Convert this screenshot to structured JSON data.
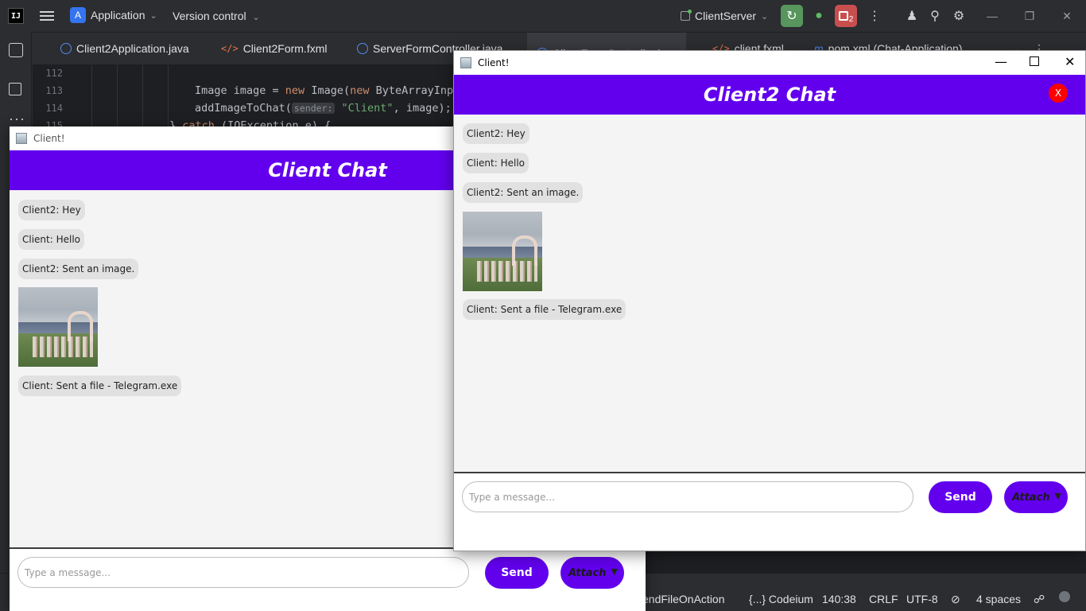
{
  "ide": {
    "logo": "IJ",
    "project": {
      "badge": "A",
      "name": "Application",
      "chevron": "⌵"
    },
    "vcs": "Version control",
    "run_config": "ClientServer",
    "stop_badge": "2",
    "tabs": [
      {
        "label": "Client2Application.java",
        "icon": "class-icon"
      },
      {
        "label": "Client2Form.fxml",
        "icon": "xml-icon"
      },
      {
        "label": "ServerFormController.java",
        "icon": "class-icon"
      },
      {
        "label": "ClientFormController.java",
        "icon": "class-icon"
      },
      {
        "label": "client.fxml",
        "icon": "xml-icon"
      },
      {
        "label": "pom.xml (Chat-Application)",
        "icon": "maven-icon"
      }
    ],
    "code": {
      "line_numbers": [
        "112",
        "113",
        "114",
        "115"
      ],
      "line113": {
        "t1": "Image image = ",
        "kw1": "new",
        "t2": " Image(",
        "kw2": "new",
        "t3": " ByteArrayInpu"
      },
      "line114": {
        "t1": "addImageToChat(",
        "hint": "sender:",
        "str": "\"Client\"",
        "t2": ", image);"
      },
      "line115": {
        "t1": "} ",
        "kw1": "catch",
        "t2": " (IOException e) {"
      }
    },
    "status": {
      "method": "endFileOnAction",
      "plugin": "{...} Codeium",
      "position": "140:38",
      "line_sep": "CRLF",
      "encoding": "UTF-8",
      "indent": "4 spaces"
    }
  },
  "client_window": {
    "title": "Client!",
    "header": "Client Chat",
    "messages": [
      {
        "type": "text",
        "text": "Client2: Hey"
      },
      {
        "type": "text",
        "text": "Client: Hello"
      },
      {
        "type": "text",
        "text": "Client2: Sent an image."
      },
      {
        "type": "image"
      },
      {
        "type": "text",
        "text": "Client: Sent a file - Telegram.exe"
      }
    ],
    "input_placeholder": "Type a message...",
    "send_label": "Send",
    "attach_label": "Attach"
  },
  "client2_window": {
    "title": "Client!",
    "header": "Client2 Chat",
    "close_label": "X",
    "messages": [
      {
        "type": "text",
        "text": "Client2: Hey"
      },
      {
        "type": "text",
        "text": "Client: Hello"
      },
      {
        "type": "text",
        "text": "Client2: Sent an image."
      },
      {
        "type": "image"
      },
      {
        "type": "text",
        "text": "Client: Sent a file - Telegram.exe"
      }
    ],
    "input_placeholder": "Type a message...",
    "send_label": "Send",
    "attach_label": "Attach"
  },
  "colors": {
    "accent": "#6200ee",
    "close_dot": "#ff0000",
    "bubble": "#e1e1e1",
    "ide_bg": "#2b2d30",
    "editor_bg": "#1e1f22"
  }
}
